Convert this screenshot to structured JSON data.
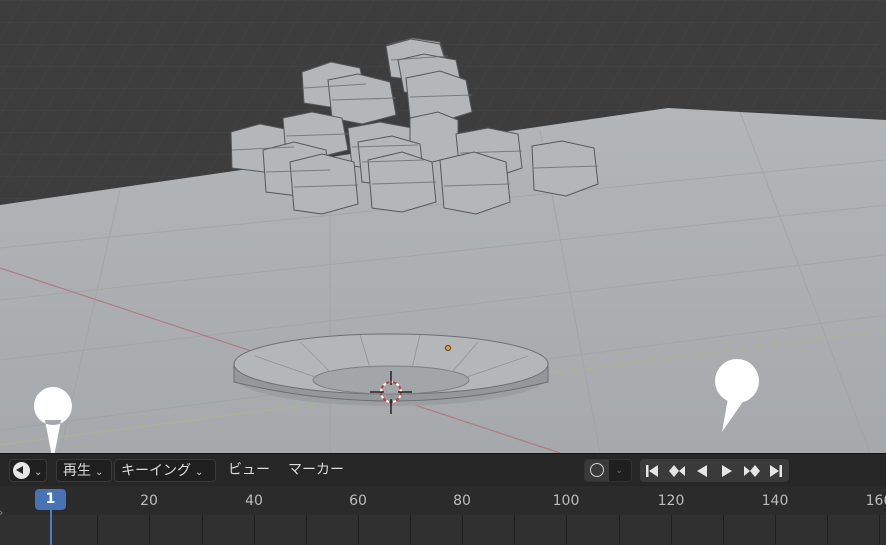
{
  "timeline": {
    "menus": {
      "playback": "再生",
      "keying": "キーイング",
      "view": "ビュー",
      "marker": "マーカー"
    },
    "current_frame": "1",
    "ruler_ticks": [
      "20",
      "40",
      "60",
      "80",
      "100",
      "120",
      "140",
      "160"
    ]
  },
  "icons": {
    "editor_type": "clock-icon",
    "record": "record-icon",
    "transport": [
      "jump-start-icon",
      "prev-keyframe-icon",
      "play-reverse-icon",
      "play-icon",
      "next-keyframe-icon",
      "jump-end-icon"
    ]
  },
  "colors": {
    "current_frame": "#4772b3",
    "header_bg": "#262626",
    "floor": "#a9acaf",
    "background": "#3d3d3d"
  }
}
